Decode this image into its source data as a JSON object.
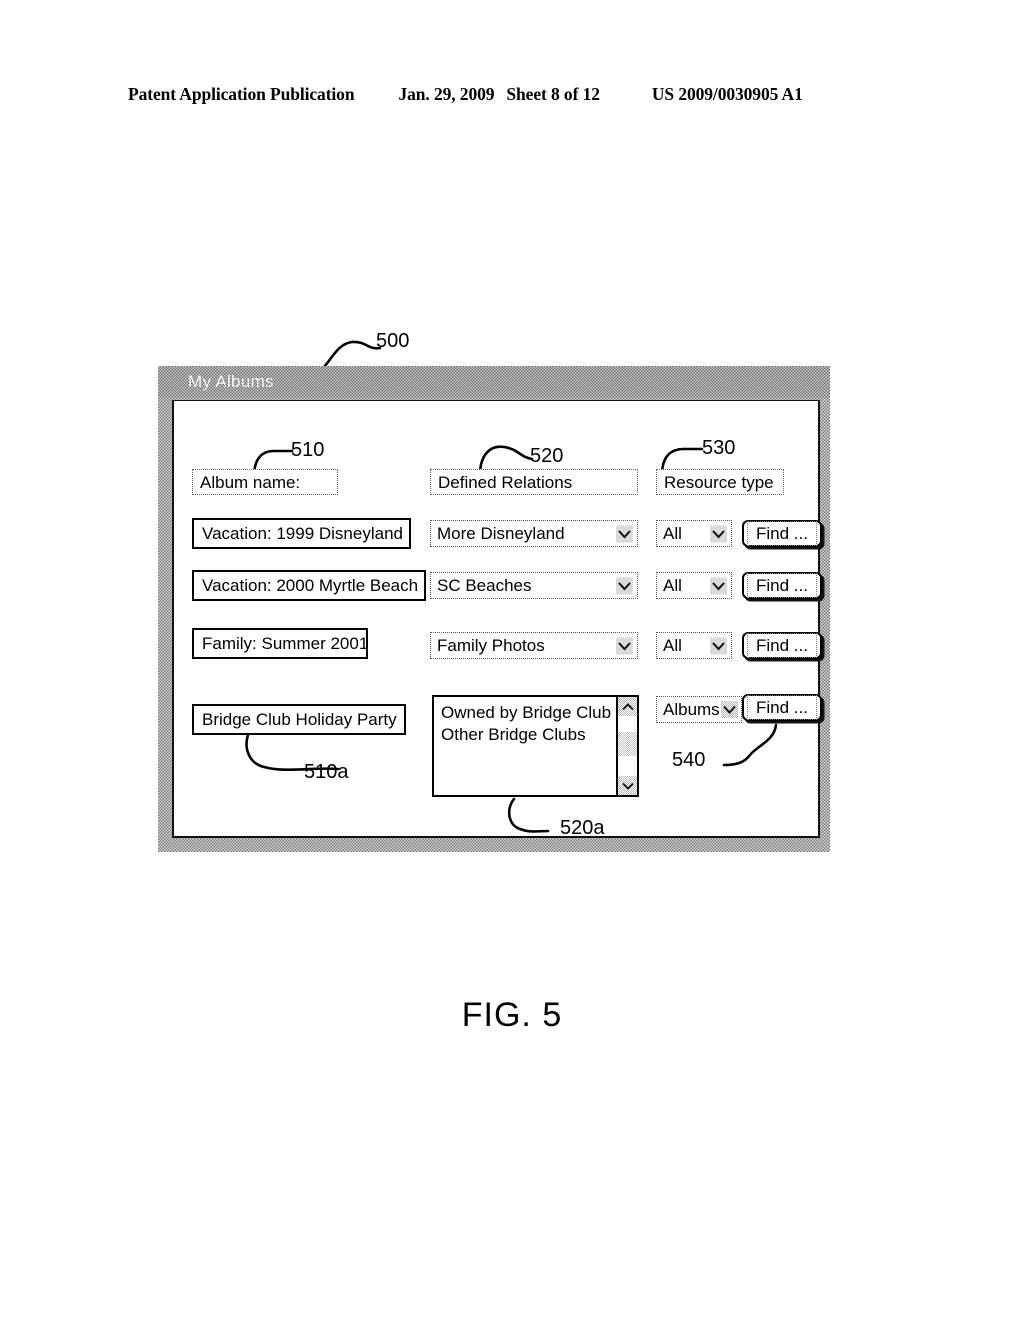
{
  "page_header": {
    "publication": "Patent Application Publication",
    "date": "Jan. 29, 2009",
    "sheet": "Sheet 8 of 12",
    "patent_number": "US 2009/0030905 A1"
  },
  "figure": {
    "caption": "FIG. 5"
  },
  "window": {
    "title": "My Albums",
    "callout": "500"
  },
  "columns": {
    "album_name": {
      "label": "Album name:",
      "callout": "510"
    },
    "defined_relations": {
      "label": "Defined Relations",
      "callout": "520"
    },
    "resource_type": {
      "label": "Resource type",
      "callout": "530"
    }
  },
  "rows": [
    {
      "album_name": "Vacation: 1999 Disneyland",
      "relation": "More Disneyland",
      "resource_type": "All",
      "find_label": "Find ..."
    },
    {
      "album_name": "Vacation: 2000 Myrtle Beach",
      "relation": "SC Beaches",
      "resource_type": "All",
      "find_label": "Find ..."
    },
    {
      "album_name": "Family: Summer 2001",
      "relation": "Family Photos",
      "resource_type": "All",
      "find_label": "Find ..."
    }
  ],
  "last_row": {
    "album_name": "Bridge Club Holiday Party",
    "album_name_callout": "510a",
    "relations_list": [
      "Owned by Bridge Club",
      "Other Bridge Clubs"
    ],
    "relations_callout": "520a",
    "resource_type": "Albums",
    "find_label": "Find ...",
    "find_callout": "540"
  },
  "icons": {
    "dropdown_chevron": "chevron-down-icon",
    "scroll_up": "scroll-up-arrow-icon",
    "scroll_down": "scroll-down-arrow-icon"
  }
}
